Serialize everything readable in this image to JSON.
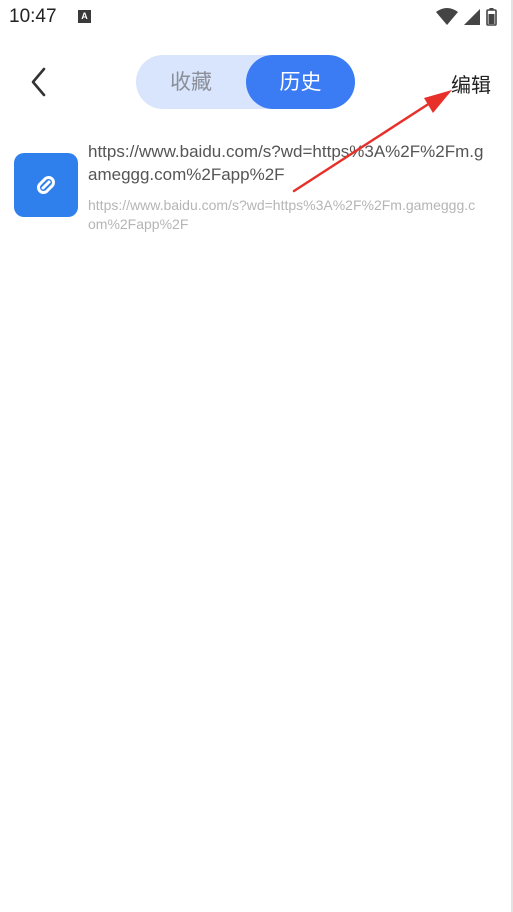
{
  "status_bar": {
    "time": "10:47",
    "a_icon": "A",
    "icons": [
      "wifi-icon",
      "signal-icon",
      "battery-icon"
    ]
  },
  "header": {
    "back_icon": "chevron-left-icon",
    "tabs": [
      {
        "label": "收藏",
        "active": false
      },
      {
        "label": "历史",
        "active": true
      }
    ],
    "edit_label": "编辑"
  },
  "history": [
    {
      "icon": "link-icon",
      "title": "https://www.baidu.com/s?wd=https%3A%2F%2Fm.gameggg.com%2Fapp%2F",
      "url": "https://www.baidu.com/s?wd=https%3A%2F%2Fm.gameggg.com%2Fapp%2F"
    }
  ],
  "colors": {
    "accent": "#3b7cf5",
    "tab_track": "#d8e5fd",
    "link_tile": "#2f80ed",
    "annotation": "#e8302a"
  }
}
